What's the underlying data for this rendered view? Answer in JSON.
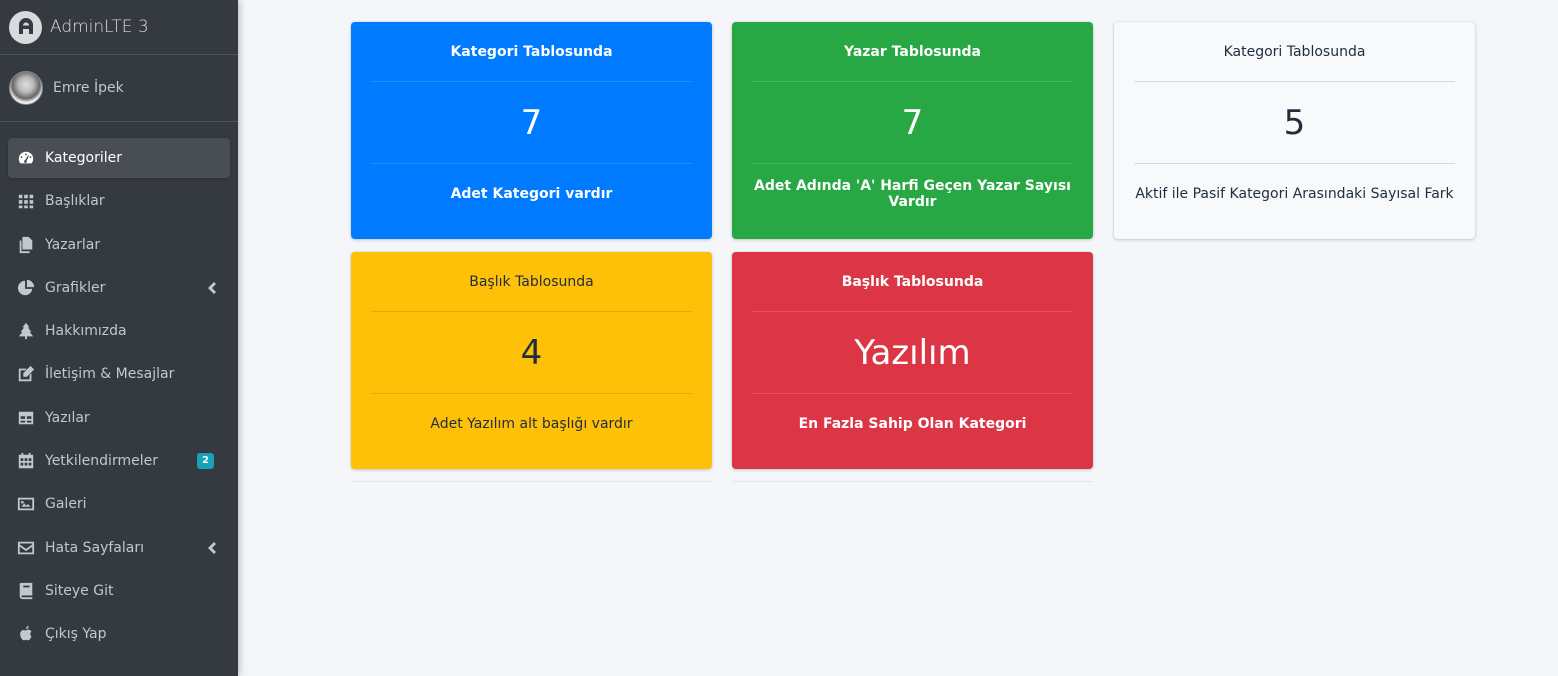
{
  "brand": {
    "name": "AdminLTE 3"
  },
  "user": {
    "name": "Emre İpek"
  },
  "sidebar": {
    "items": [
      {
        "label": "Kategoriler",
        "icon": "tachometer-icon"
      },
      {
        "label": "Başlıklar",
        "icon": "grid-icon"
      },
      {
        "label": "Yazarlar",
        "icon": "copy-icon"
      },
      {
        "label": "Grafikler",
        "icon": "pie-chart-icon"
      },
      {
        "label": "Hakkımızda",
        "icon": "tree-icon"
      },
      {
        "label": "İletişim & Mesajlar",
        "icon": "edit-icon"
      },
      {
        "label": "Yazılar",
        "icon": "table-icon"
      },
      {
        "label": "Yetkilendirmeler",
        "icon": "calendar-icon",
        "badge": "2"
      },
      {
        "label": "Galeri",
        "icon": "image-icon"
      },
      {
        "label": "Hata Sayfaları",
        "icon": "envelope-icon"
      },
      {
        "label": "Siteye Git",
        "icon": "book-icon"
      },
      {
        "label": "Çıkış Yap",
        "icon": "apple-icon"
      }
    ]
  },
  "cards": [
    {
      "header": "Kategori Tablosunda",
      "value": "7",
      "footer": "Adet Kategori vardır",
      "color": "#007bff"
    },
    {
      "header": "Yazar Tablosunda",
      "value": "7",
      "footer": "Adet Adında 'A' Harfi Geçen Yazar Sayısı Vardır",
      "color": "#28a745"
    },
    {
      "header": "Kategori Tablosunda",
      "value": "5",
      "footer": "Aktif ile Pasif Kategori Arasındaki Sayısal Fark",
      "color": "#f8f9fa"
    },
    {
      "header": "Başlık Tablosunda",
      "value": "4",
      "footer": "Adet Yazılım alt başlığı vardır",
      "color": "#ffc107"
    },
    {
      "header": "Başlık Tablosunda",
      "value": "Yazılım",
      "footer": "En Fazla Sahip Olan Kategori",
      "color": "#dc3545"
    }
  ]
}
